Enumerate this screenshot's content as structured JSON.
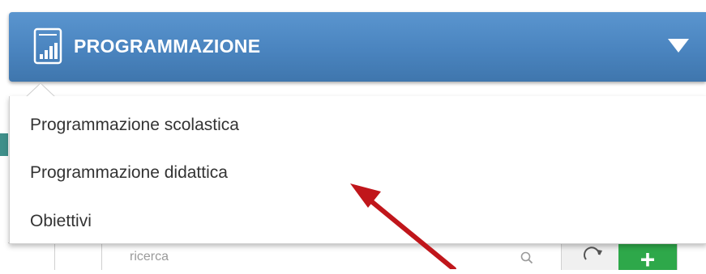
{
  "header": {
    "title": "PROGRAMMAZIONE",
    "icon": "chart-document-icon",
    "caret_icon": "caret-down-icon",
    "color": "#4a84bf"
  },
  "menu": {
    "items": [
      {
        "label": "Programmazione scolastica"
      },
      {
        "label": "Programmazione didattica"
      },
      {
        "label": "Obiettivi"
      }
    ]
  },
  "background": {
    "search_placeholder": "ricerca",
    "search_icon": "search-icon",
    "refresh_icon": "refresh-icon",
    "add_icon": "plus-icon",
    "add_color": "#2ea84a"
  },
  "annotation": {
    "arrow_color": "#c0161b"
  }
}
